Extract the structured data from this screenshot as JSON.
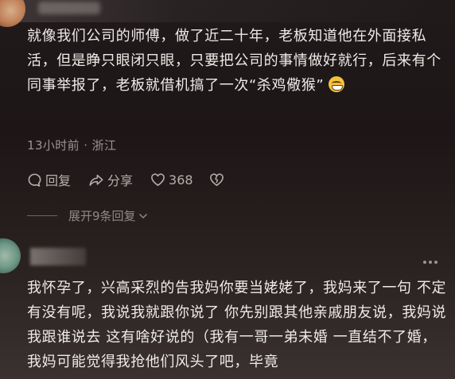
{
  "comment1": {
    "text": "就像我们公司的师傅，做了近二十年，老板知道他在外面接私活，但是睁只眼闭只眼，只要把公司的事情做好就行，后来有个同事举报了，老板就借机搞了一次“杀鸡儆猴”",
    "emoji": "grinning-emoji",
    "meta": "13小时前 · 浙江",
    "actions": {
      "reply_label": "回复",
      "share_label": "分享",
      "like_count": "368"
    },
    "expand_label": "展开9条回复"
  },
  "comment2": {
    "text": "我怀孕了，兴高采烈的告我妈你要当姥姥了，我妈来了一句 不定有没有呢，我说我就跟你说了 你先别跟其他亲戚朋友说，我妈说 我跟谁说去 这有啥好说的（我有一哥一弟未婚 一直结不了婚，我妈可能觉得我抢他们风头了吧，毕竟"
  },
  "colors": {
    "background": "#1b1516",
    "text": "#efeae8",
    "meta": "#9b9492",
    "emoji": "#f6c23a"
  }
}
